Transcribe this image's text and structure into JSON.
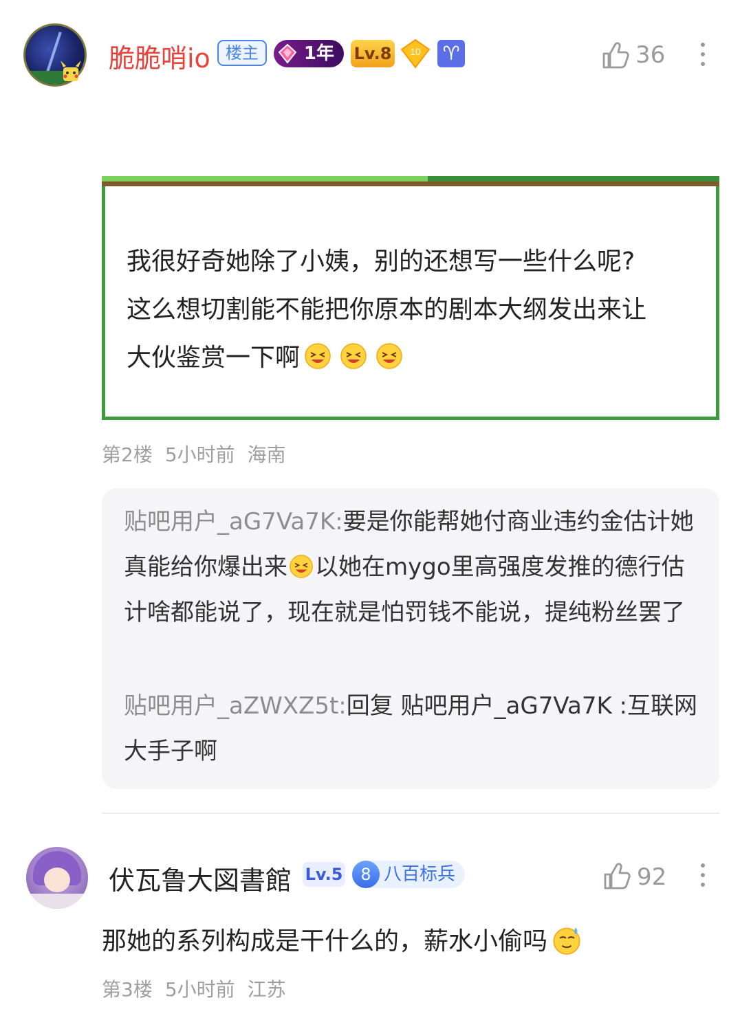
{
  "post1": {
    "username": "脆脆哨io",
    "badges": {
      "owner": "楼主",
      "membership_years": "1年",
      "level": "Lv.8",
      "fan_level": "10",
      "zodiac_icon": "aries-icon"
    },
    "likes": "36",
    "quote_lines": [
      "我很好奇她除了小姨，别的还想写一些什么呢?",
      "这么想切割能不能把你原本的剧本大纲发出来让",
      "大伙鉴赏一下啊"
    ],
    "floor": "第2楼",
    "time": "5小时前",
    "location": "海南",
    "replies": [
      {
        "user": "贴吧用户_aG7Va7K:",
        "text_a": "要是你能帮她付商业违约金估计她真能给你爆出来",
        "text_b": "以她在mygo里高强度发推的德行估计啥都能说了，现在就是怕罚钱不能说，提纯粉丝罢了"
      },
      {
        "user": "贴吧用户_aZWXZ5t:",
        "text": "回复 贴吧用户_aG7Va7K :互联网大手子啊"
      }
    ]
  },
  "post2": {
    "username": "伏瓦鲁大図書館",
    "badges": {
      "level": "Lv.5",
      "rank_number": "8",
      "rank_title": "八百标兵"
    },
    "likes": "92",
    "comment": "那她的系列构成是干什么的，薪水小偷吗",
    "floor": "第3楼",
    "time": "5小时前",
    "location": "江苏"
  },
  "colors": {
    "owner_name": "#e8433d",
    "meta_gray": "#9e9e9e",
    "quote_border": "#3d9a3d",
    "reply_bg": "#f5f5f7"
  }
}
